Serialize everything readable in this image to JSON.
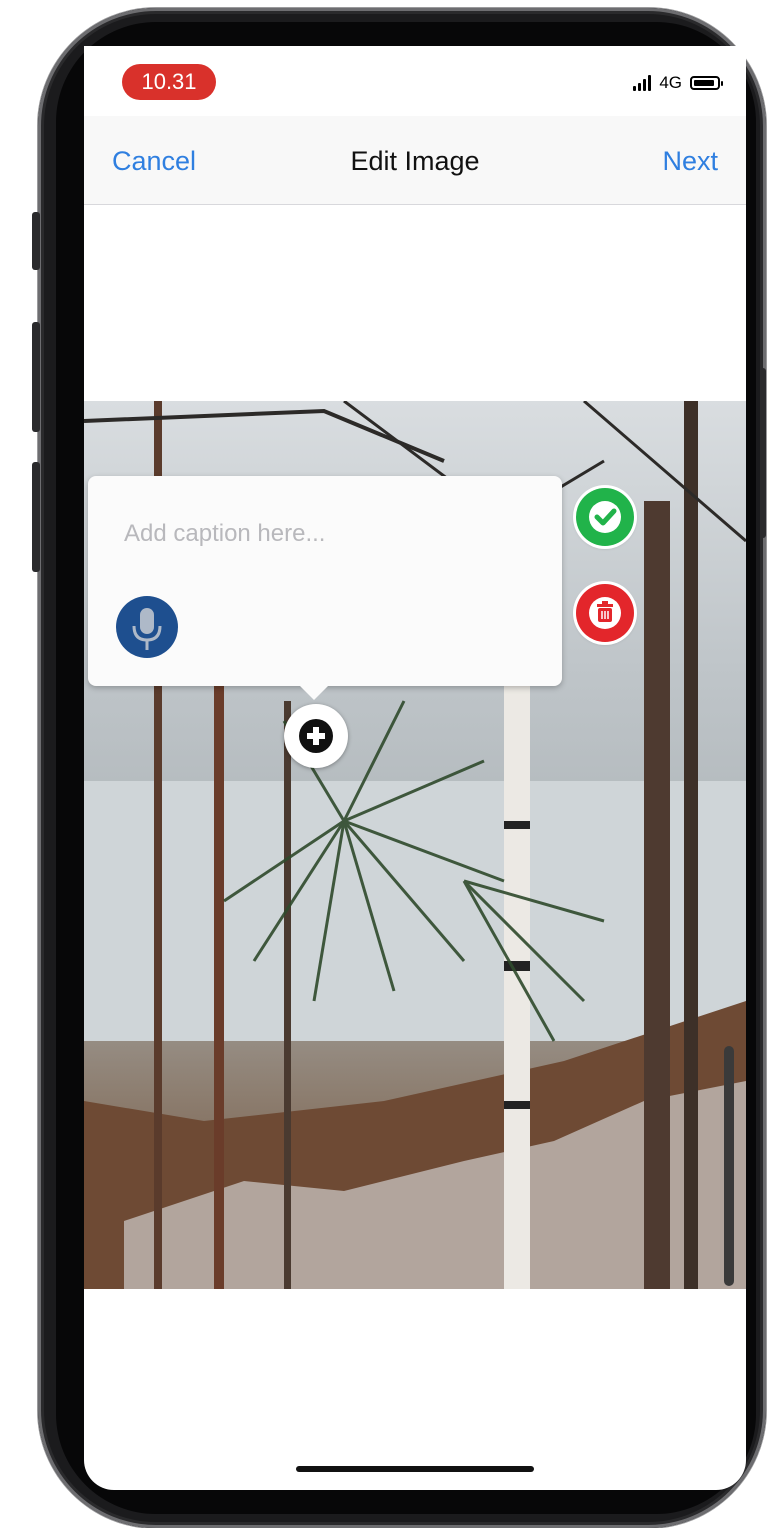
{
  "status_bar": {
    "time": "10.31",
    "network": "4G",
    "icons": [
      "signal-icon",
      "battery-icon"
    ]
  },
  "nav": {
    "cancel_label": "Cancel",
    "title": "Edit Image",
    "next_label": "Next"
  },
  "caption": {
    "placeholder": "Add caption here..."
  },
  "icons": {
    "mic": "microphone-icon",
    "confirm": "checkmark-icon",
    "delete": "trash-icon",
    "add": "plus-icon"
  },
  "colors": {
    "accent": "#2f7fe0",
    "time_pill": "#d9312b",
    "confirm": "#21b34a",
    "delete": "#e3262b",
    "mic": "#1e4f8f"
  }
}
